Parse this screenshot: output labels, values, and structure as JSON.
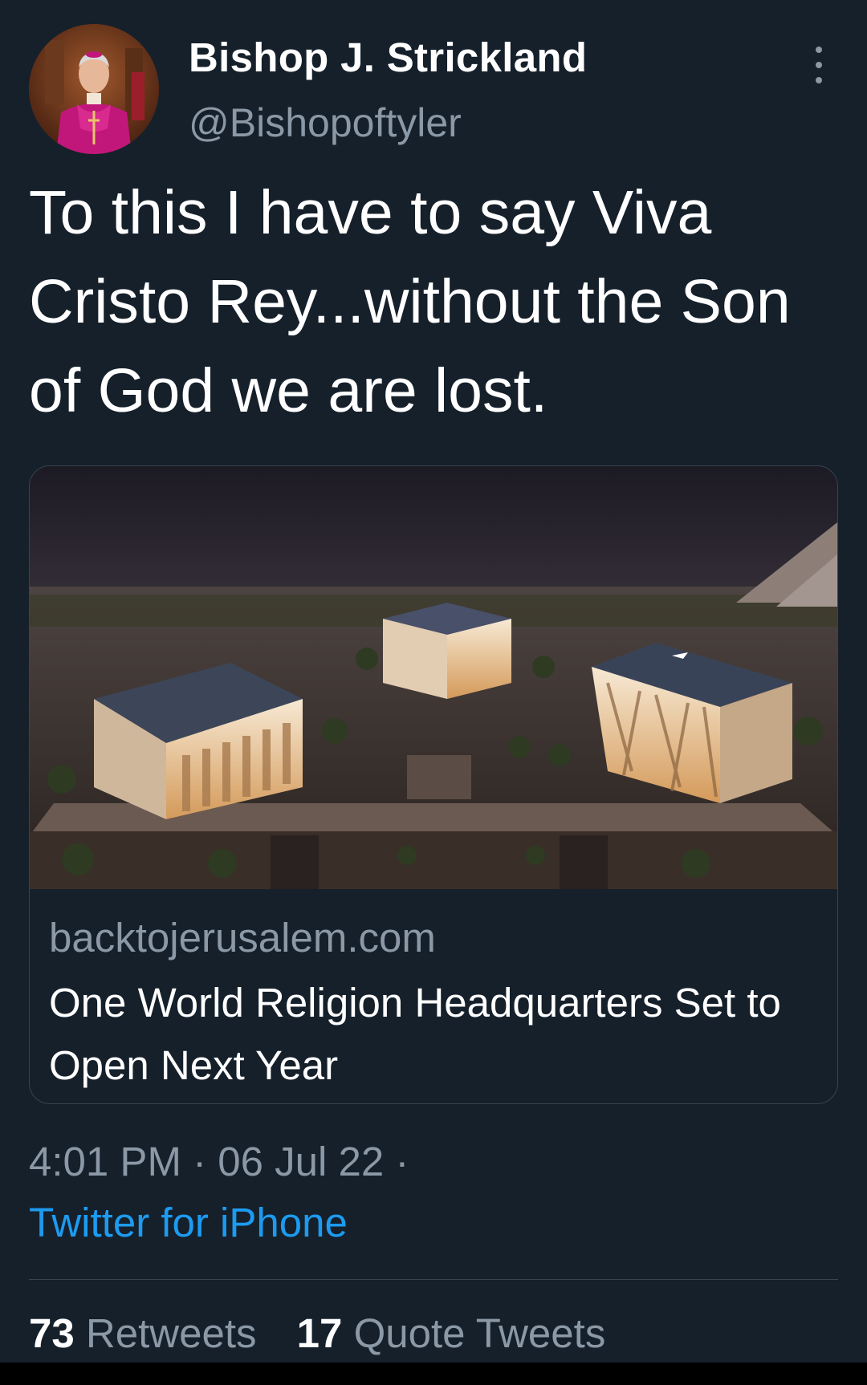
{
  "author": {
    "display_name": "Bishop J. Strickland",
    "handle": "@Bishopoftyler",
    "avatar_icon": "bishop-portrait-avatar"
  },
  "tweet": {
    "text": "To this I have to say Viva Cristo Rey...without the Son of God we are lost."
  },
  "link_card": {
    "image_icon": "abrahamic-family-house-rendering",
    "domain": "backtojerusalem.com",
    "title": "One World Religion Headquarters Set to Open Next Year"
  },
  "meta": {
    "timestamp": "4:01 PM · 06 Jul 22 ·",
    "source": "Twitter for iPhone"
  },
  "stats": {
    "retweets_count": "73",
    "retweets_label": "Retweets",
    "quotes_count": "17",
    "quotes_label": "Quote Tweets"
  },
  "colors": {
    "background": "#15202b",
    "text_primary": "#ffffff",
    "text_secondary": "#8b98a5",
    "link": "#1d9bf0",
    "border": "#38444d"
  }
}
